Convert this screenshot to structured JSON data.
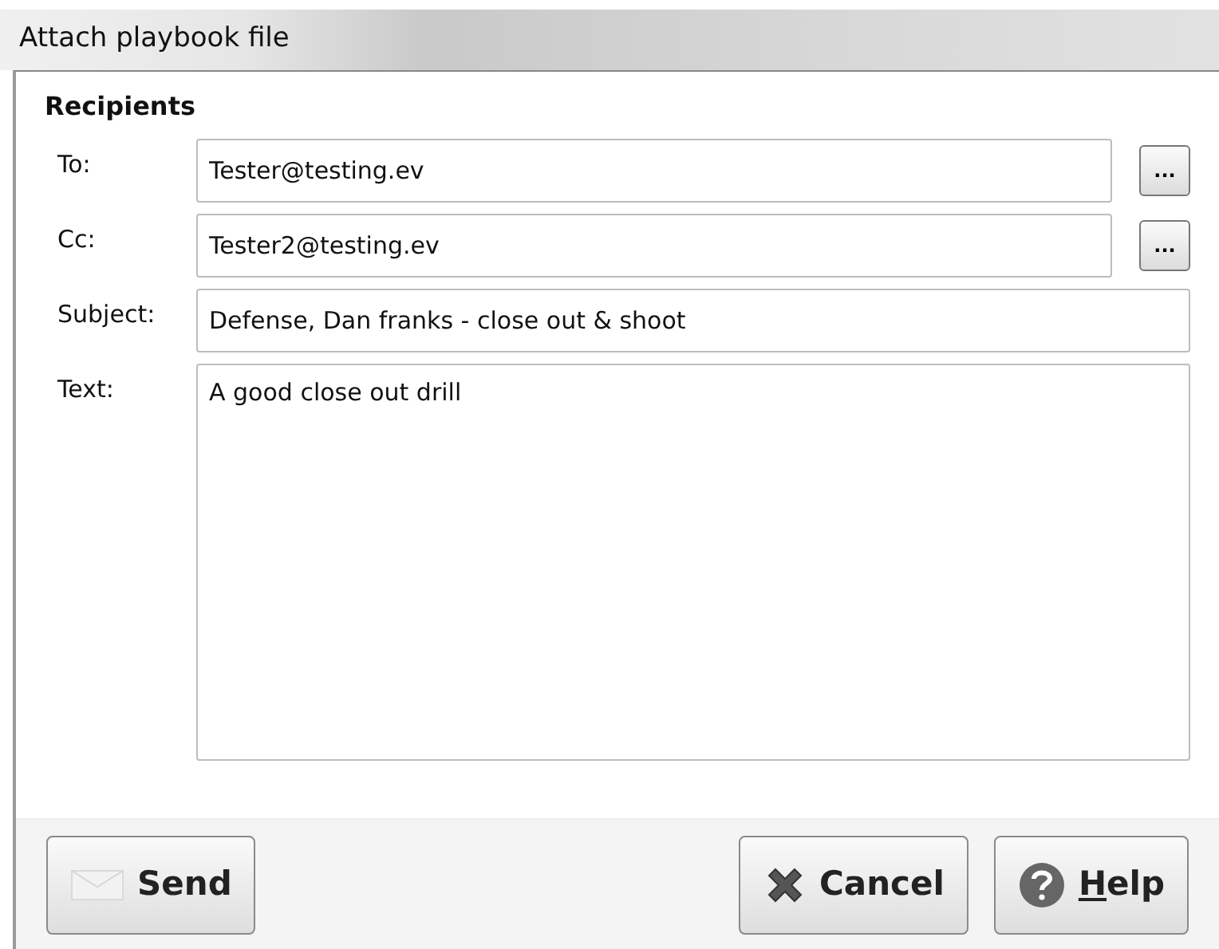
{
  "window": {
    "title": "Attach playbook file"
  },
  "section": {
    "title": "Recipients"
  },
  "fields": [
    {
      "kind": "picker",
      "label": "To:",
      "value": "Tester@testing.ev",
      "button": "..."
    },
    {
      "kind": "picker",
      "label": "Cc:",
      "value": "Tester2@testing.ev",
      "button": "..."
    },
    {
      "kind": "line",
      "label": "Subject:",
      "value": "Defense, Dan franks - close out & shoot"
    },
    {
      "kind": "area",
      "label": "Text:",
      "value": "A good close out drill"
    }
  ],
  "buttons": [
    {
      "kind": "send",
      "label": "Send",
      "underline_first": false
    },
    {
      "kind": "cancel",
      "label": "Cancel",
      "underline_first": false
    },
    {
      "kind": "help",
      "label": "Help",
      "underline_first": true
    }
  ]
}
